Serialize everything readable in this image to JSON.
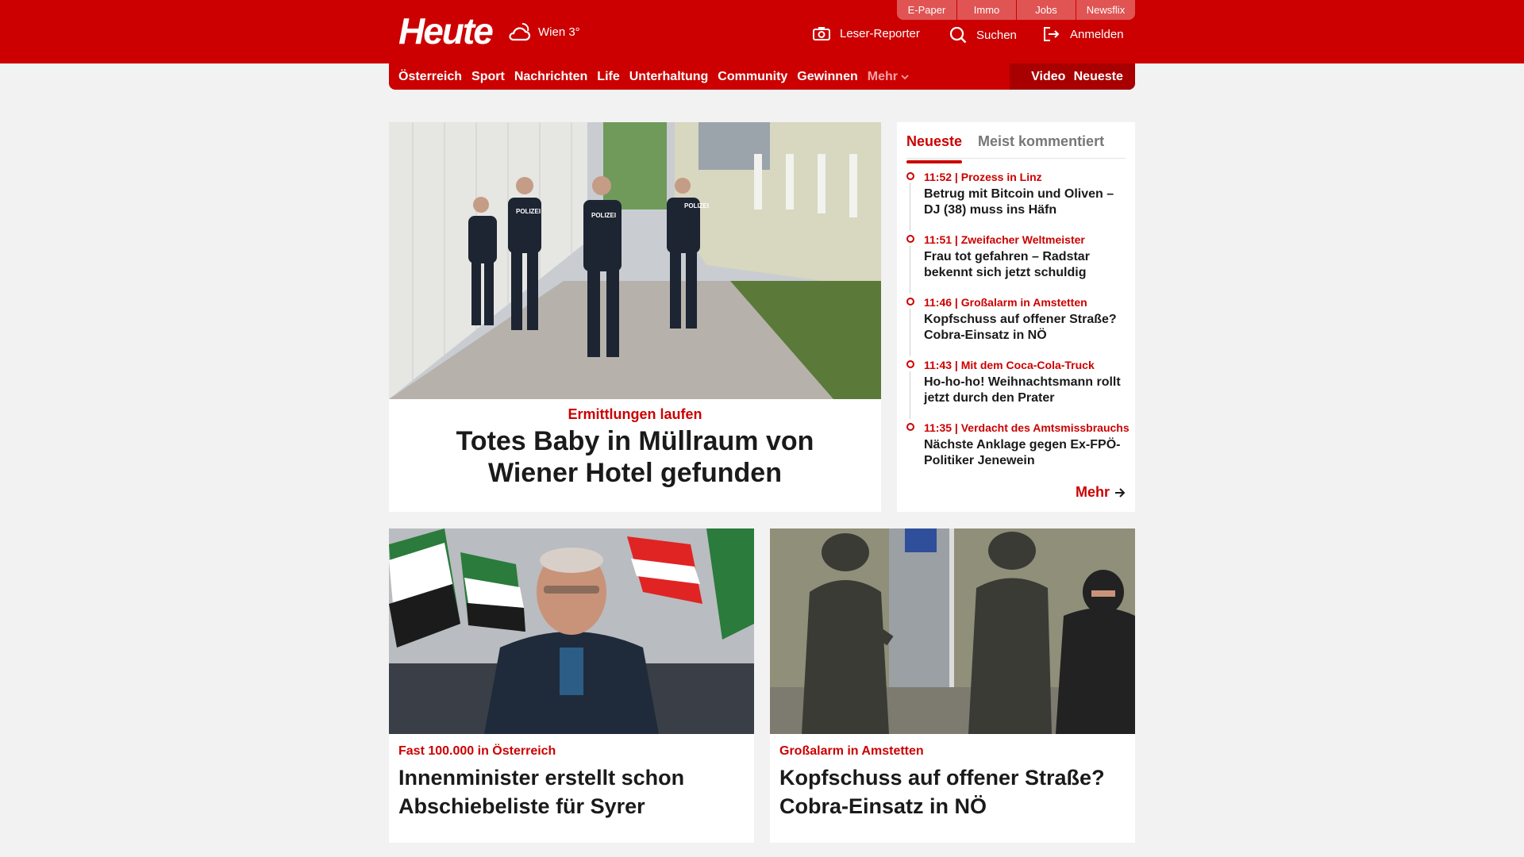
{
  "header": {
    "logo": "Heute",
    "weather": "Wien 3°",
    "service_tabs": [
      "E-Paper",
      "Immo",
      "Jobs",
      "Newsflix"
    ],
    "reporter": "Leser-Reporter",
    "search": "Suchen",
    "login": "Anmelden"
  },
  "nav": {
    "items": [
      "Österreich",
      "Sport",
      "Nachrichten",
      "Life",
      "Unterhaltung",
      "Community",
      "Gewinnen"
    ],
    "more": "Mehr",
    "video": "Video",
    "latest": "Neueste"
  },
  "hero": {
    "kicker": "Ermittlungen laufen",
    "headline": "Totes Baby in Müllraum von Wiener Hotel gefunden"
  },
  "sidebar": {
    "tabs": [
      "Neueste",
      "Meist kommentiert"
    ],
    "items": [
      {
        "meta": "11:52 | Prozess in Linz",
        "title": "Betrug mit Bitcoin und Oliven – DJ (38) muss ins Häfn"
      },
      {
        "meta": "11:51 | Zweifacher Weltmeister",
        "title": "Frau tot gefahren – Radstar bekennt sich jetzt schuldig"
      },
      {
        "meta": "11:46 | Großalarm in Amstetten",
        "title": "Kopfschuss auf offener Straße? Cobra-Einsatz in NÖ"
      },
      {
        "meta": "11:43 | Mit dem Coca-Cola-Truck",
        "title": "Ho-ho-ho! Weihnachtsmann rollt jetzt durch den Prater"
      },
      {
        "meta": "11:35 | Verdacht des Amtsmissbrauchs",
        "title": "Nächste Anklage gegen Ex-FPÖ-Politiker Jenewein"
      }
    ],
    "more": "Mehr"
  },
  "cards": [
    {
      "kicker": "Fast 100.000 in Österreich",
      "headline": "Innenminister erstellt schon Abschiebeliste für Syrer"
    },
    {
      "kicker": "Großalarm in Amstetten",
      "headline": "Kopfschuss auf offener Straße? Cobra-Einsatz in NÖ"
    }
  ],
  "colors": {
    "brand": "#cc0000",
    "background": "#f2f2f2"
  }
}
